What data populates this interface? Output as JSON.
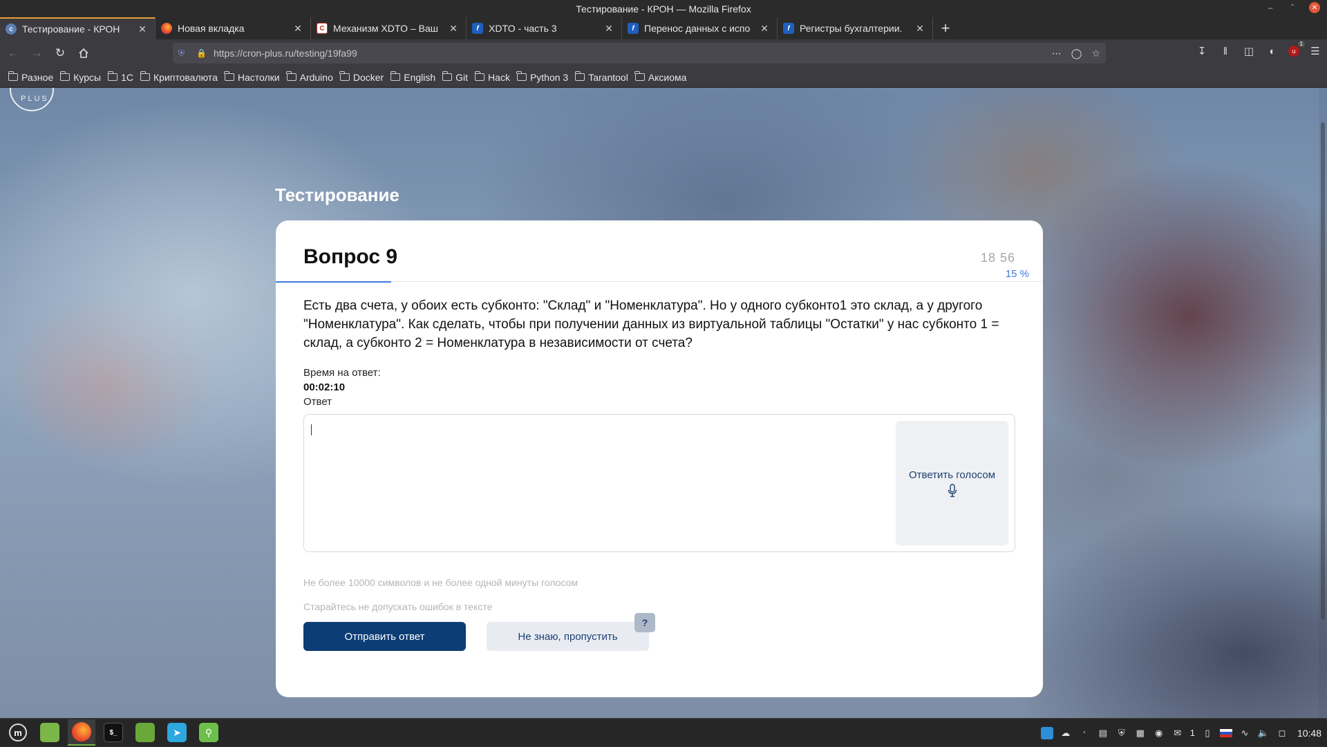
{
  "window": {
    "title": "Тестирование - КРОН — Mozilla Firefox"
  },
  "tabs": [
    {
      "label": "Тестирование - КРОН",
      "icon": "kron-icon",
      "active": true
    },
    {
      "label": "Новая вкладка",
      "icon": "firefox-icon",
      "active": false
    },
    {
      "label": "Механизм XDTO – Ваш",
      "icon": "site-icon",
      "active": false
    },
    {
      "label": "XDTO - часть 3",
      "icon": "infostart-icon",
      "active": false
    },
    {
      "label": "Перенос данных с испо",
      "icon": "infostart-icon",
      "active": false
    },
    {
      "label": "Регистры бухгалтерии.",
      "icon": "infostart-icon",
      "active": false
    }
  ],
  "nav": {
    "url": "https://cron-plus.ru/testing/19fa99"
  },
  "bookmarks": [
    "Разное",
    "Курсы",
    "1С",
    "Криптовалюта",
    "Настолки",
    "Arduino",
    "Docker",
    "English",
    "Git",
    "Hack",
    "Python 3",
    "Tarantool",
    "Аксиома"
  ],
  "page": {
    "logo_text": "PLUS",
    "heading": "Тестирование",
    "question_title": "Вопрос 9",
    "time_left": "18 56",
    "progress_percent_label": "15 %",
    "progress_value": 0.15,
    "question_text": "Есть два счета, у обоих есть субконто: \"Склад\" и \"Номенклатура\". Но у одного субконто1 это склад, а у другого \"Номенклатура\". Как сделать, чтобы при получении данных из виртуальной таблицы \"Остатки\" у нас субконто 1 = склад, а субконто 2 = Номенклатура в независимости от счета?",
    "timer_label": "Время на ответ:",
    "timer_value": "00:02:10",
    "answer_label": "Ответ",
    "answer_value": "",
    "voice_button": "Ответить голосом",
    "hint_limit": "Не более 10000 символов и не более одной минуты голосом",
    "hint_errors": "Старайтесь не допускать ошибок в тексте",
    "submit_button": "Отправить ответ",
    "skip_button": "Не знаю, пропустить",
    "help_button": "?"
  },
  "taskbar": {
    "apps": [
      "mint-menu-icon",
      "files-icon",
      "firefox-icon",
      "terminal-icon",
      "folder-icon",
      "telegram-icon",
      "keepass-icon"
    ],
    "tray_badge": "1",
    "clock": "10:48"
  },
  "colors": {
    "accent_blue": "#3d7be0",
    "primary_button": "#0d3d75",
    "firefox_active_tab_highlight": "#e8a03a"
  }
}
